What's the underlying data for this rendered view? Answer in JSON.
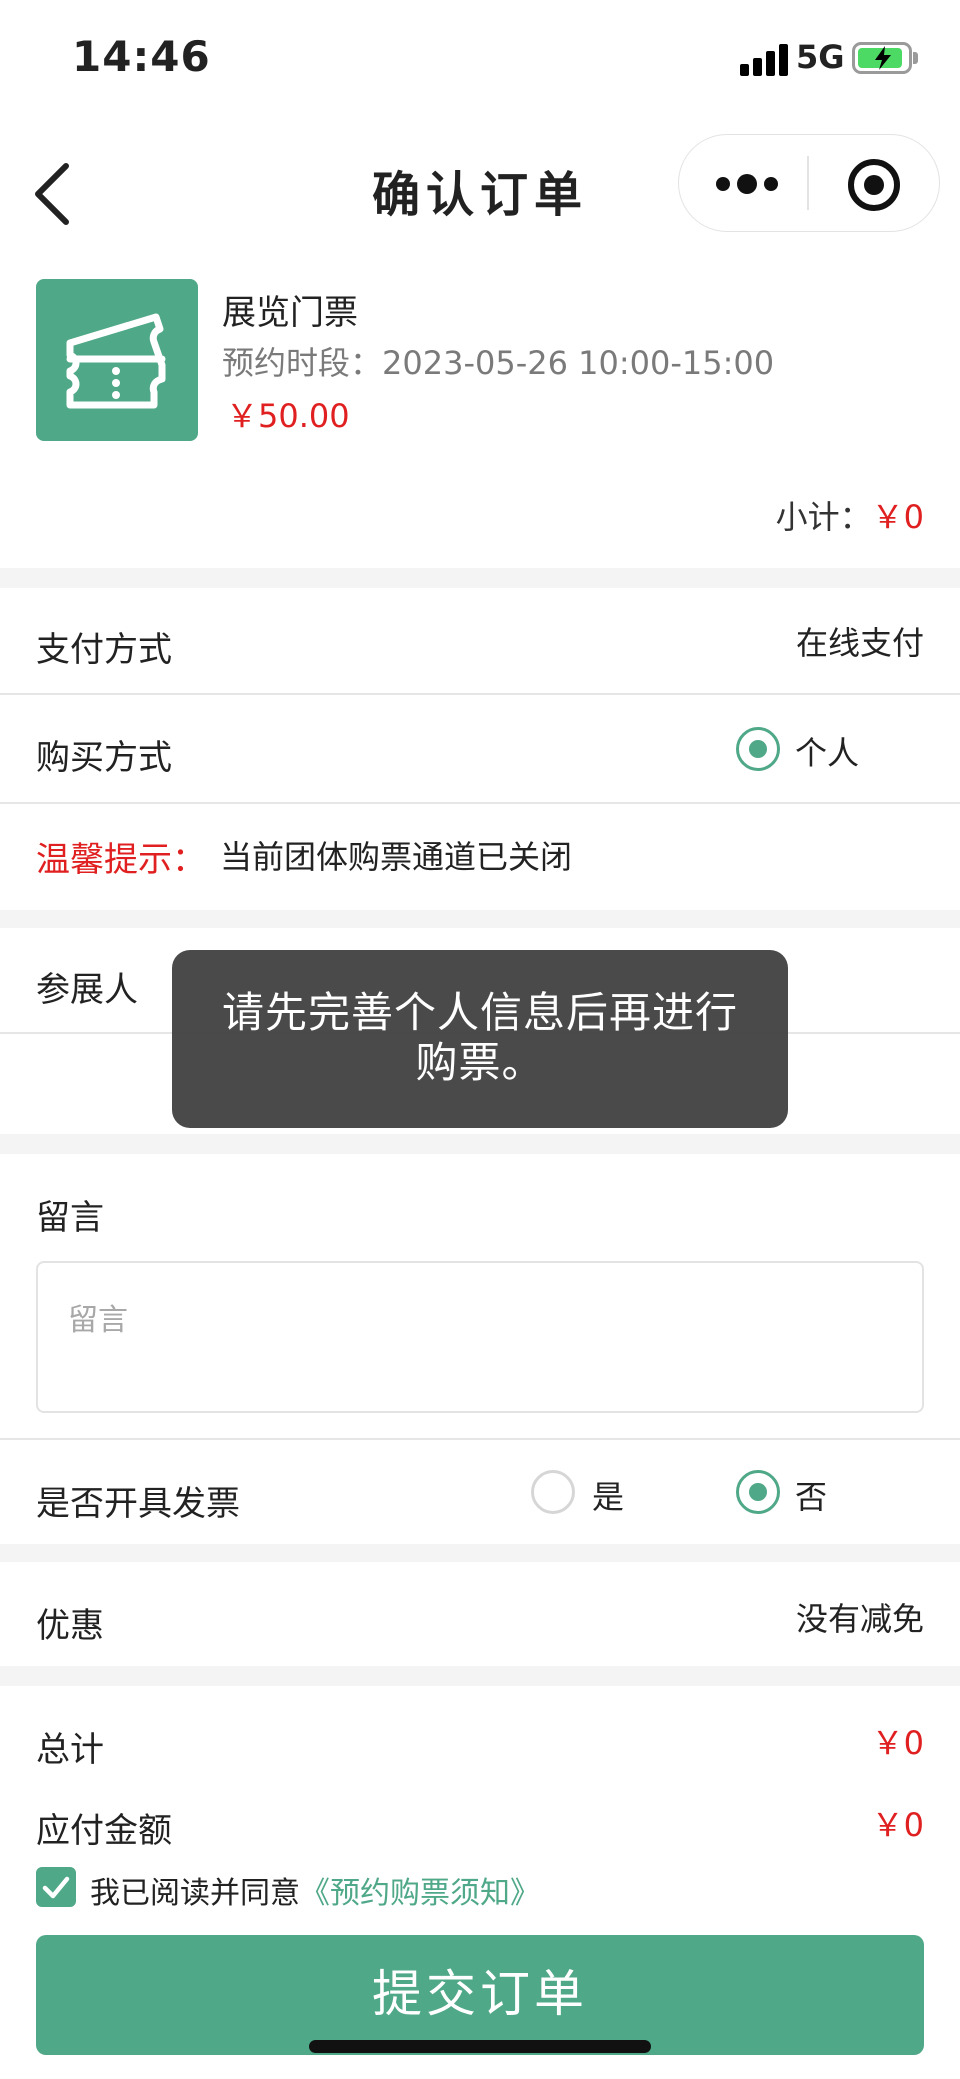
{
  "status_bar": {
    "time": "14:46",
    "network": "5G"
  },
  "nav": {
    "title": "确认订单"
  },
  "product": {
    "name": "展览门票",
    "time_slot": "预约时段：2023-05-26 10:00-15:00",
    "price": "￥50.00",
    "subtotal_label": "小计：",
    "subtotal_value": "￥0",
    "icon": "ticket-icon"
  },
  "payment": {
    "label": "支付方式",
    "value": "在线支付"
  },
  "purchase": {
    "label": "购买方式",
    "option": "个人",
    "selected": true
  },
  "tip": {
    "label": "温馨提示：",
    "text": "当前团体购票通道已关闭"
  },
  "visitor": {
    "label": "参展人"
  },
  "message": {
    "label": "留言",
    "placeholder": "留言",
    "value": ""
  },
  "invoice": {
    "label": "是否开具发票",
    "options": [
      "是",
      "否"
    ],
    "selected": "否"
  },
  "discount": {
    "label": "优惠",
    "value": "没有减免"
  },
  "totals": {
    "total_label": "总计",
    "total_value": "￥0",
    "payable_label": "应付金额",
    "payable_value": "￥0"
  },
  "agreement": {
    "checked": true,
    "text": "我已阅读并同意",
    "link": "《预约购票须知》"
  },
  "submit": {
    "label": "提交订单"
  },
  "toast": {
    "text": "请先完善个人信息后再进行购票。"
  },
  "colors": {
    "accent": "#4fa887",
    "price": "#e02020",
    "background": "#f4f4f4"
  }
}
